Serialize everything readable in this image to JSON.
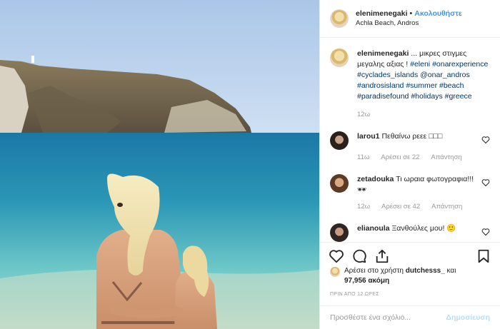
{
  "post": {
    "photo_alt": "",
    "colors": {
      "sky": "#b7d0ec",
      "sea_deep": "#1e7ea8",
      "sea_shallow": "#6ec9cc",
      "sand": "#d9c7a8",
      "hair": "#f3e6b5",
      "skin": "#d9a27e"
    }
  },
  "header": {
    "username": "elenimenegaki",
    "separator": "•",
    "follow_label": "Ακολουθήστε",
    "location": "Achla Beach, Andros"
  },
  "caption": {
    "username": "elenimenegaki",
    "text_before": "... μικρες στιγμες μεγαλης αξιας ! ",
    "tags": [
      "#eleni",
      "#onarexperience",
      "#cyclades_islands",
      "@onar_andros",
      "#androsisland",
      "#summer",
      "#beach",
      "#paradisefound",
      "#holidays",
      "#greece"
    ],
    "age": "12ω"
  },
  "comments": [
    {
      "username": "larou1",
      "text": "Πεθαίνω ρεεε □□□",
      "age": "11ω",
      "likes": "Αρέσει σε 22",
      "reply": "Απάντηση",
      "avatar": "av-dark"
    },
    {
      "username": "zetadouka",
      "text": "Τι ωραια φωτογραφια!!! 🕶",
      "age": "12ω",
      "likes": "Αρέσει σε 42",
      "reply": "Απάντηση",
      "avatar": "av-brown"
    },
    {
      "username": "elianoula",
      "text": "Ξανθούλες μου! 🙂",
      "age": "",
      "likes": "",
      "reply": "",
      "avatar": "av-ocean"
    }
  ],
  "actions": {
    "like_icon": "heart-icon",
    "comment_icon": "comment-icon",
    "share_icon": "share-icon",
    "save_icon": "bookmark-icon"
  },
  "likes": {
    "prefix": "Αρέσει στο χρήστη ",
    "user": "dutchesss_",
    "middle": " και ",
    "count": "97,956 ακόμη"
  },
  "timestamp": "ΠΡΙΝ ΑΠΟ 12 ΩΡΕΣ",
  "add_comment": {
    "placeholder": "Προσθέστε ένα σχόλιο...",
    "post_label": "Δημοσίευση"
  }
}
